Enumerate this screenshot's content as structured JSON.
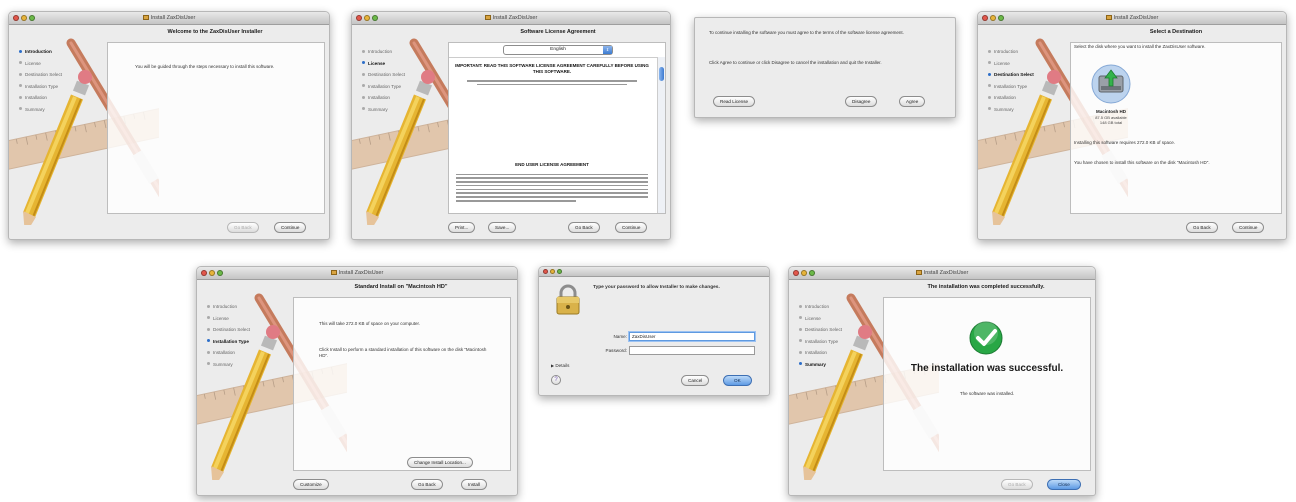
{
  "window_title": "Install ZaxDisUser",
  "steps": [
    "Introduction",
    "License",
    "Destination Select",
    "Installation Type",
    "Installation",
    "Summary"
  ],
  "screen1": {
    "heading": "Welcome to the ZaxDisUser Installer",
    "body": "You will be guided through the steps necessary to install this software.",
    "go_back": "Go Back",
    "continue": "Continue"
  },
  "screen2": {
    "heading": "Software License Agreement",
    "language": "English",
    "license_heading": "IMPORTANT: READ THIS SOFTWARE LICENSE AGREEMENT CAREFULLY BEFORE USING THIS SOFTWARE.",
    "eula_heading": "END USER LICENSE AGREEMENT",
    "print": "Print...",
    "save": "Save...",
    "go_back": "Go Back",
    "continue": "Continue"
  },
  "screen3": {
    "text1": "To continue installing the software you must agree to the terms of the software license agreement.",
    "text2": "Click Agree to continue or click Disagree to cancel the installation and quit the Installer.",
    "read_license": "Read License",
    "disagree": "Disagree",
    "agree": "Agree"
  },
  "screen4": {
    "heading": "Select a Destination",
    "prompt": "Select the disk where you want to install the ZaxDisUser software.",
    "disk_name": "Macintosh HD",
    "disk_info1": "87.5 GB available",
    "disk_info2": "148 GB total",
    "requires": "Installing this software requires 272.0 KB of space.",
    "chosen": "You have chosen to install this software on the disk \"Macintosh HD\".",
    "go_back": "Go Back",
    "continue": "Continue"
  },
  "screen5": {
    "heading": "Standard Install on \"Macintosh HD\"",
    "text1": "This will take 272.0 KB of space on your computer.",
    "text2": "Click Install to perform a standard installation of this software on the disk \"Macintosh HD\".",
    "change_location": "Change Install Location...",
    "customize": "Customize",
    "go_back": "Go Back",
    "install": "Install"
  },
  "screen6": {
    "prompt": "Type your password to allow Installer to make changes.",
    "name_label": "Name:",
    "name_value": "ZaxDisUser",
    "password_label": "Password:",
    "details": "Details",
    "cancel": "Cancel",
    "ok": "OK"
  },
  "screen7": {
    "heading": "The installation was completed successfully.",
    "success": "The installation was successful.",
    "installed": "The software was installed.",
    "go_back": "Go Back",
    "close": "Close"
  },
  "colors": {
    "accent_blue": "#3c7bd1",
    "success_green": "#28a745",
    "window_bg": "#ececec"
  }
}
